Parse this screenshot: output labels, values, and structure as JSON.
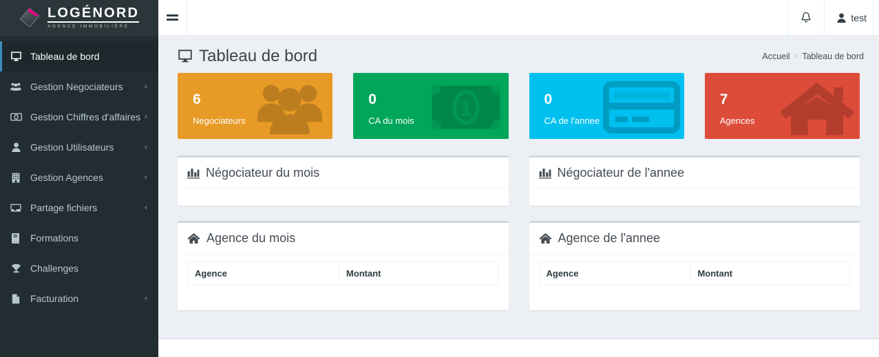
{
  "brand": {
    "logo_title": "LOGÉNORD",
    "logo_subtitle": "AGENCE IMMOBILIÈRE",
    "logo_icon": "diamond-logo-icon",
    "accent_color": "#e5007d",
    "sidebar_color": "#222d32",
    "logo_box_color": "#2a3639"
  },
  "topbar": {
    "menu_toggle_icon": "hamburger-icon",
    "notifications_icon": "bell-icon",
    "user_icon": "user-icon",
    "user_name": "test"
  },
  "sidebar": {
    "items": [
      {
        "label": "Tableau de bord",
        "icon": "desktop-icon",
        "caret": "",
        "active": true
      },
      {
        "label": "Gestion Negociateurs",
        "icon": "users-icon",
        "caret": "‹",
        "active": false
      },
      {
        "label": "Gestion Chiffres d'affaires",
        "icon": "money-icon",
        "caret": "‹",
        "active": false
      },
      {
        "label": "Gestion Utilisateurs",
        "icon": "user-icon",
        "caret": "‹",
        "active": false
      },
      {
        "label": "Gestion Agences",
        "icon": "building-icon",
        "caret": "‹",
        "active": false
      },
      {
        "label": "Partage fichiers",
        "icon": "inbox-icon",
        "caret": "‹",
        "active": false
      },
      {
        "label": "Formations",
        "icon": "book-icon",
        "caret": "",
        "active": false
      },
      {
        "label": "Challenges",
        "icon": "trophy-icon",
        "caret": "",
        "active": false
      },
      {
        "label": "Facturation",
        "icon": "file-icon",
        "caret": "‹",
        "active": false
      }
    ]
  },
  "header": {
    "title": "Tableau de bord",
    "title_icon": "desktop-icon",
    "breadcrumb": {
      "home": "Accueil",
      "separator": "›",
      "current": "Tableau de bord"
    }
  },
  "stats": [
    {
      "value": "6",
      "label": "Negociateurs",
      "color": "#e79a25",
      "icon": "users-group-icon"
    },
    {
      "value": "0",
      "label": "CA du mois",
      "color": "#00a65a",
      "icon": "money-bill-icon"
    },
    {
      "value": "0",
      "label": "CA de l'annee",
      "color": "#00c0ef",
      "icon": "credit-card-icon"
    },
    {
      "value": "7",
      "label": "Agences",
      "color": "#dd4b39",
      "icon": "home-icon"
    }
  ],
  "panels": {
    "negotiator_month": {
      "title": "Négociateur du mois",
      "icon": "bar-chart-icon",
      "rows": []
    },
    "negotiator_year": {
      "title": "Négociateur de l'annee",
      "icon": "bar-chart-icon",
      "rows": []
    },
    "agency_month": {
      "title": "Agence du mois",
      "icon": "home-icon",
      "columns": [
        "Agence",
        "Montant"
      ],
      "rows": []
    },
    "agency_year": {
      "title": "Agence de l'annee",
      "icon": "home-icon",
      "columns": [
        "Agence",
        "Montant"
      ],
      "rows": []
    }
  }
}
